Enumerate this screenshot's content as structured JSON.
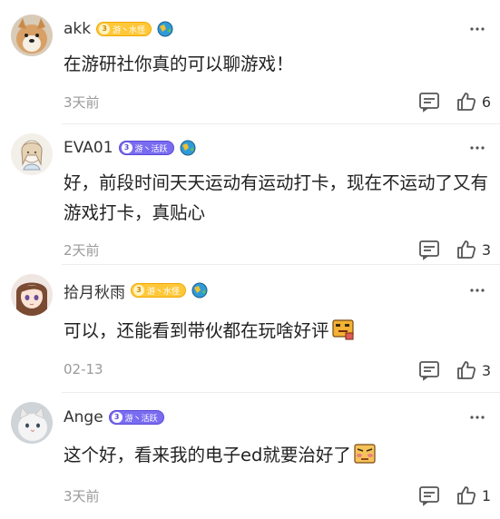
{
  "comments": [
    {
      "username": "akk",
      "badge": {
        "level": "3",
        "text": "游丶水怪",
        "style": "gold"
      },
      "text": "在游研社你真的可以聊游戏！",
      "time": "3天前",
      "likes": "6",
      "avatar": "shiba-dog"
    },
    {
      "username": "EVA01",
      "badge": {
        "level": "3",
        "text": "游丶活跃",
        "style": "purple"
      },
      "text": "好，前段时间天天运动有运动打卡，现在不运动了又有游戏打卡，真贴心",
      "time": "2天前",
      "likes": "3",
      "avatar": "anime-girl-sketch"
    },
    {
      "username": "拾月秋雨",
      "badge": {
        "level": "3",
        "text": "游丶水怪",
        "style": "gold"
      },
      "text": "可以，还能看到带伙都在玩啥好评",
      "emoji": "thumbs-up-sticker",
      "time": "02-13",
      "likes": "3",
      "avatar": "anime-girl-brown-hair"
    },
    {
      "username": "Ange",
      "badge": {
        "level": "3",
        "text": "游丶活跃",
        "style": "purple"
      },
      "text": "这个好，看来我的电子ed就要治好了",
      "emoji": "shy-face-sticker",
      "time": "3天前",
      "likes": "1",
      "avatar": "white-cat"
    }
  ],
  "colors": {
    "gold_badge": "#ffc83a",
    "purple_badge": "#7a6cf0",
    "muted_text": "#9a9a9a"
  }
}
